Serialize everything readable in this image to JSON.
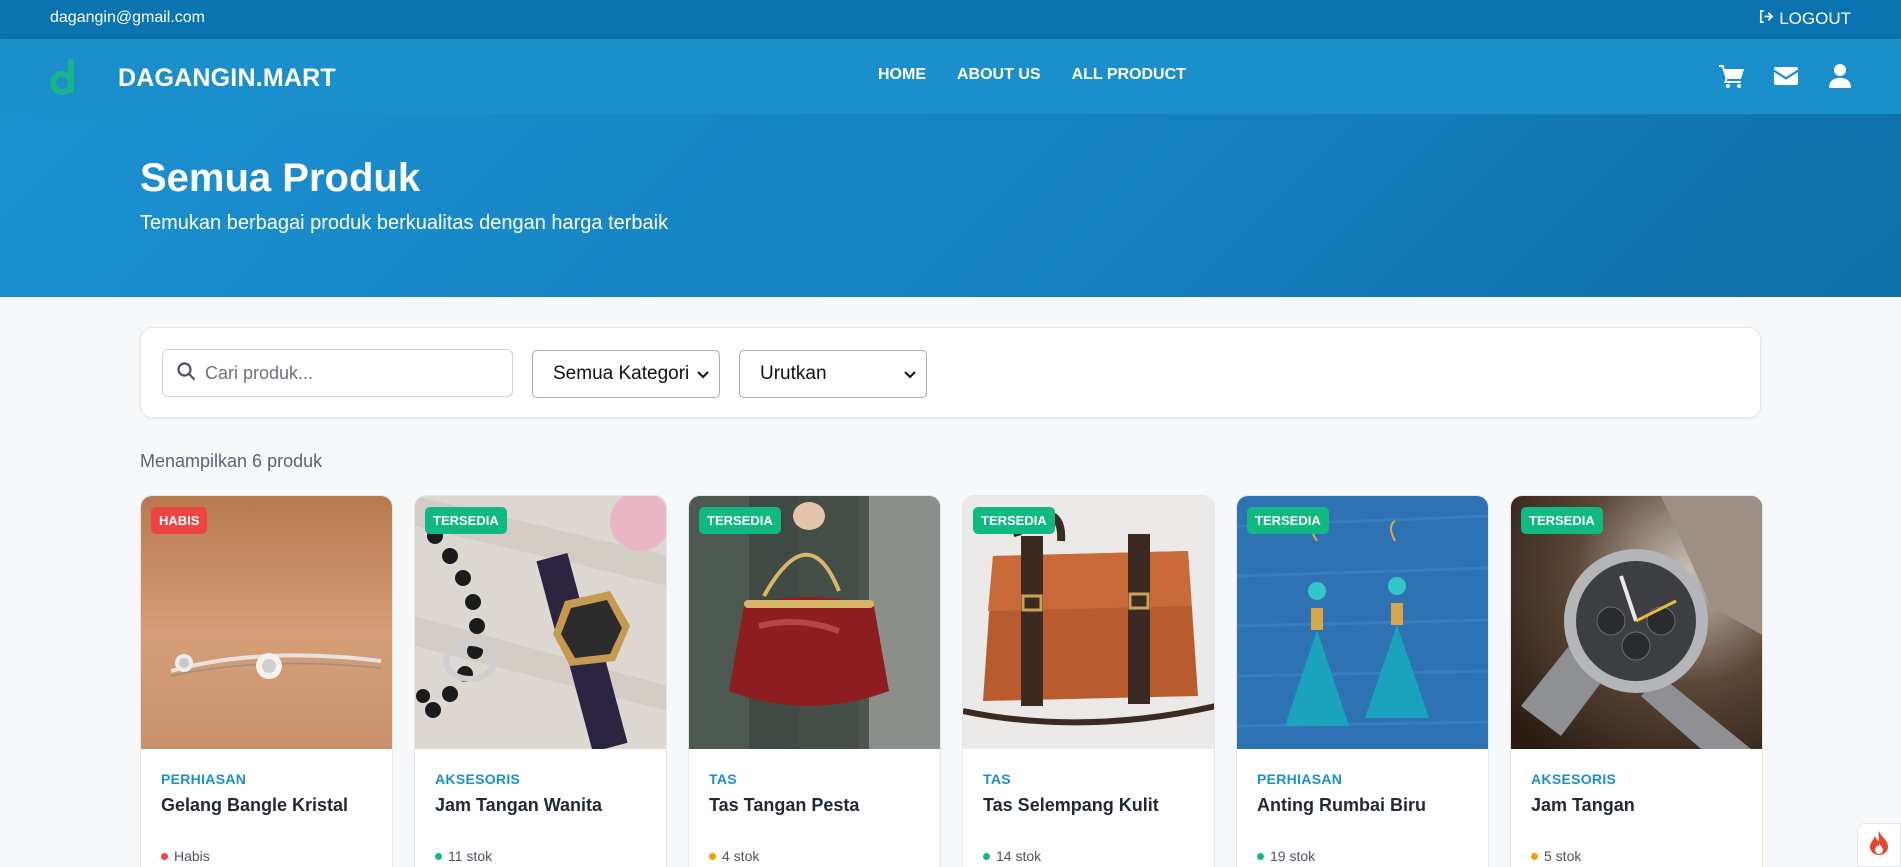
{
  "topbar": {
    "email": "dagangin@gmail.com",
    "logout_label": "LOGOUT"
  },
  "navbar": {
    "brand": "DAGANGIN.MART",
    "links": [
      "HOME",
      "ABOUT US",
      "ALL PRODUCT"
    ],
    "icons": [
      "cart-icon",
      "envelope-icon",
      "user-icon"
    ]
  },
  "hero": {
    "title": "Semua Produk",
    "subtitle": "Temukan berbagai produk berkualitas dengan harga terbaik"
  },
  "filters": {
    "search_placeholder": "Cari produk...",
    "category_selected": "Semua Kategori",
    "sort_selected": "Urutkan"
  },
  "result_count": "Menampilkan 6 produk",
  "products": [
    {
      "badge": "HABIS",
      "category": "PERHIASAN",
      "name": "Gelang Bangle Kristal",
      "stock": "Habis",
      "status_color": "#ef4444"
    },
    {
      "badge": "TERSEDIA",
      "category": "AKSESORIS",
      "name": "Jam Tangan Wanita",
      "stock": "11 stok",
      "status_color": "#10b981"
    },
    {
      "badge": "TERSEDIA",
      "category": "TAS",
      "name": "Tas Tangan Pesta",
      "stock": "4 stok",
      "status_color": "#f59e0b"
    },
    {
      "badge": "TERSEDIA",
      "category": "TAS",
      "name": "Tas Selempang Kulit",
      "stock": "14 stok",
      "status_color": "#10b981"
    },
    {
      "badge": "TERSEDIA",
      "category": "PERHIASAN",
      "name": "Anting Rumbai Biru",
      "stock": "19 stok",
      "status_color": "#10b981"
    },
    {
      "badge": "TERSEDIA",
      "category": "AKSESORIS",
      "name": "Jam Tangan",
      "stock": "5 stok",
      "status_color": "#f59e0b"
    }
  ],
  "colors": {
    "primary": "#1b8fcc",
    "topbar": "#0b74b0",
    "available": "#10b981",
    "sold_out": "#ef4444",
    "low_stock": "#f59e0b"
  }
}
